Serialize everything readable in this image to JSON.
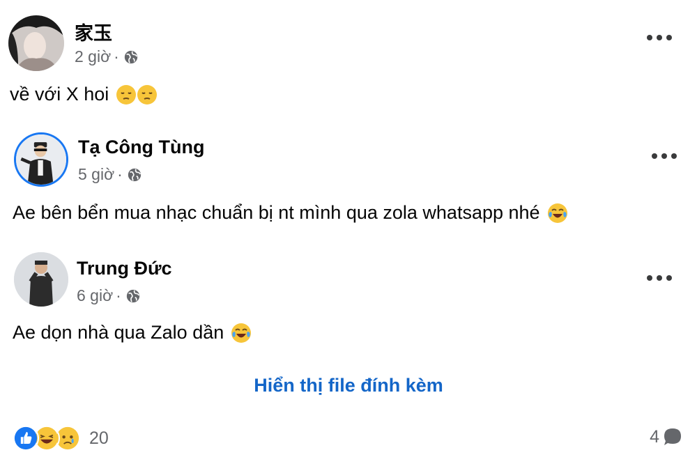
{
  "posts": [
    {
      "author": "家玉",
      "time": "2 giờ",
      "separator": "·",
      "text": "về với X hoi",
      "emojis": [
        "pensive-emoji",
        "pensive-emoji"
      ]
    },
    {
      "author": "Tạ Công Tùng",
      "time": "5 giờ",
      "separator": "·",
      "text": "Ae bên bển mua nhạc chuẩn bị nt mình qua zola whatsapp nhé",
      "emojis": [
        "tears-of-joy-emoji"
      ]
    },
    {
      "author": "Trung Đức",
      "time": "6 giờ",
      "separator": "·",
      "text": "Ae dọn nhà qua Zalo dần",
      "emojis": [
        "tears-of-joy-emoji"
      ]
    }
  ],
  "attachment_link": "Hiển thị file đính kèm",
  "footer": {
    "reactions": [
      "like-icon",
      "haha-icon",
      "sad-icon"
    ],
    "reaction_count": "20",
    "comment_count": "4"
  },
  "colors": {
    "link": "#1466c8",
    "meta": "#65676b",
    "like_blue": "#1877f2",
    "emoji_yellow": "#f7c53a"
  }
}
